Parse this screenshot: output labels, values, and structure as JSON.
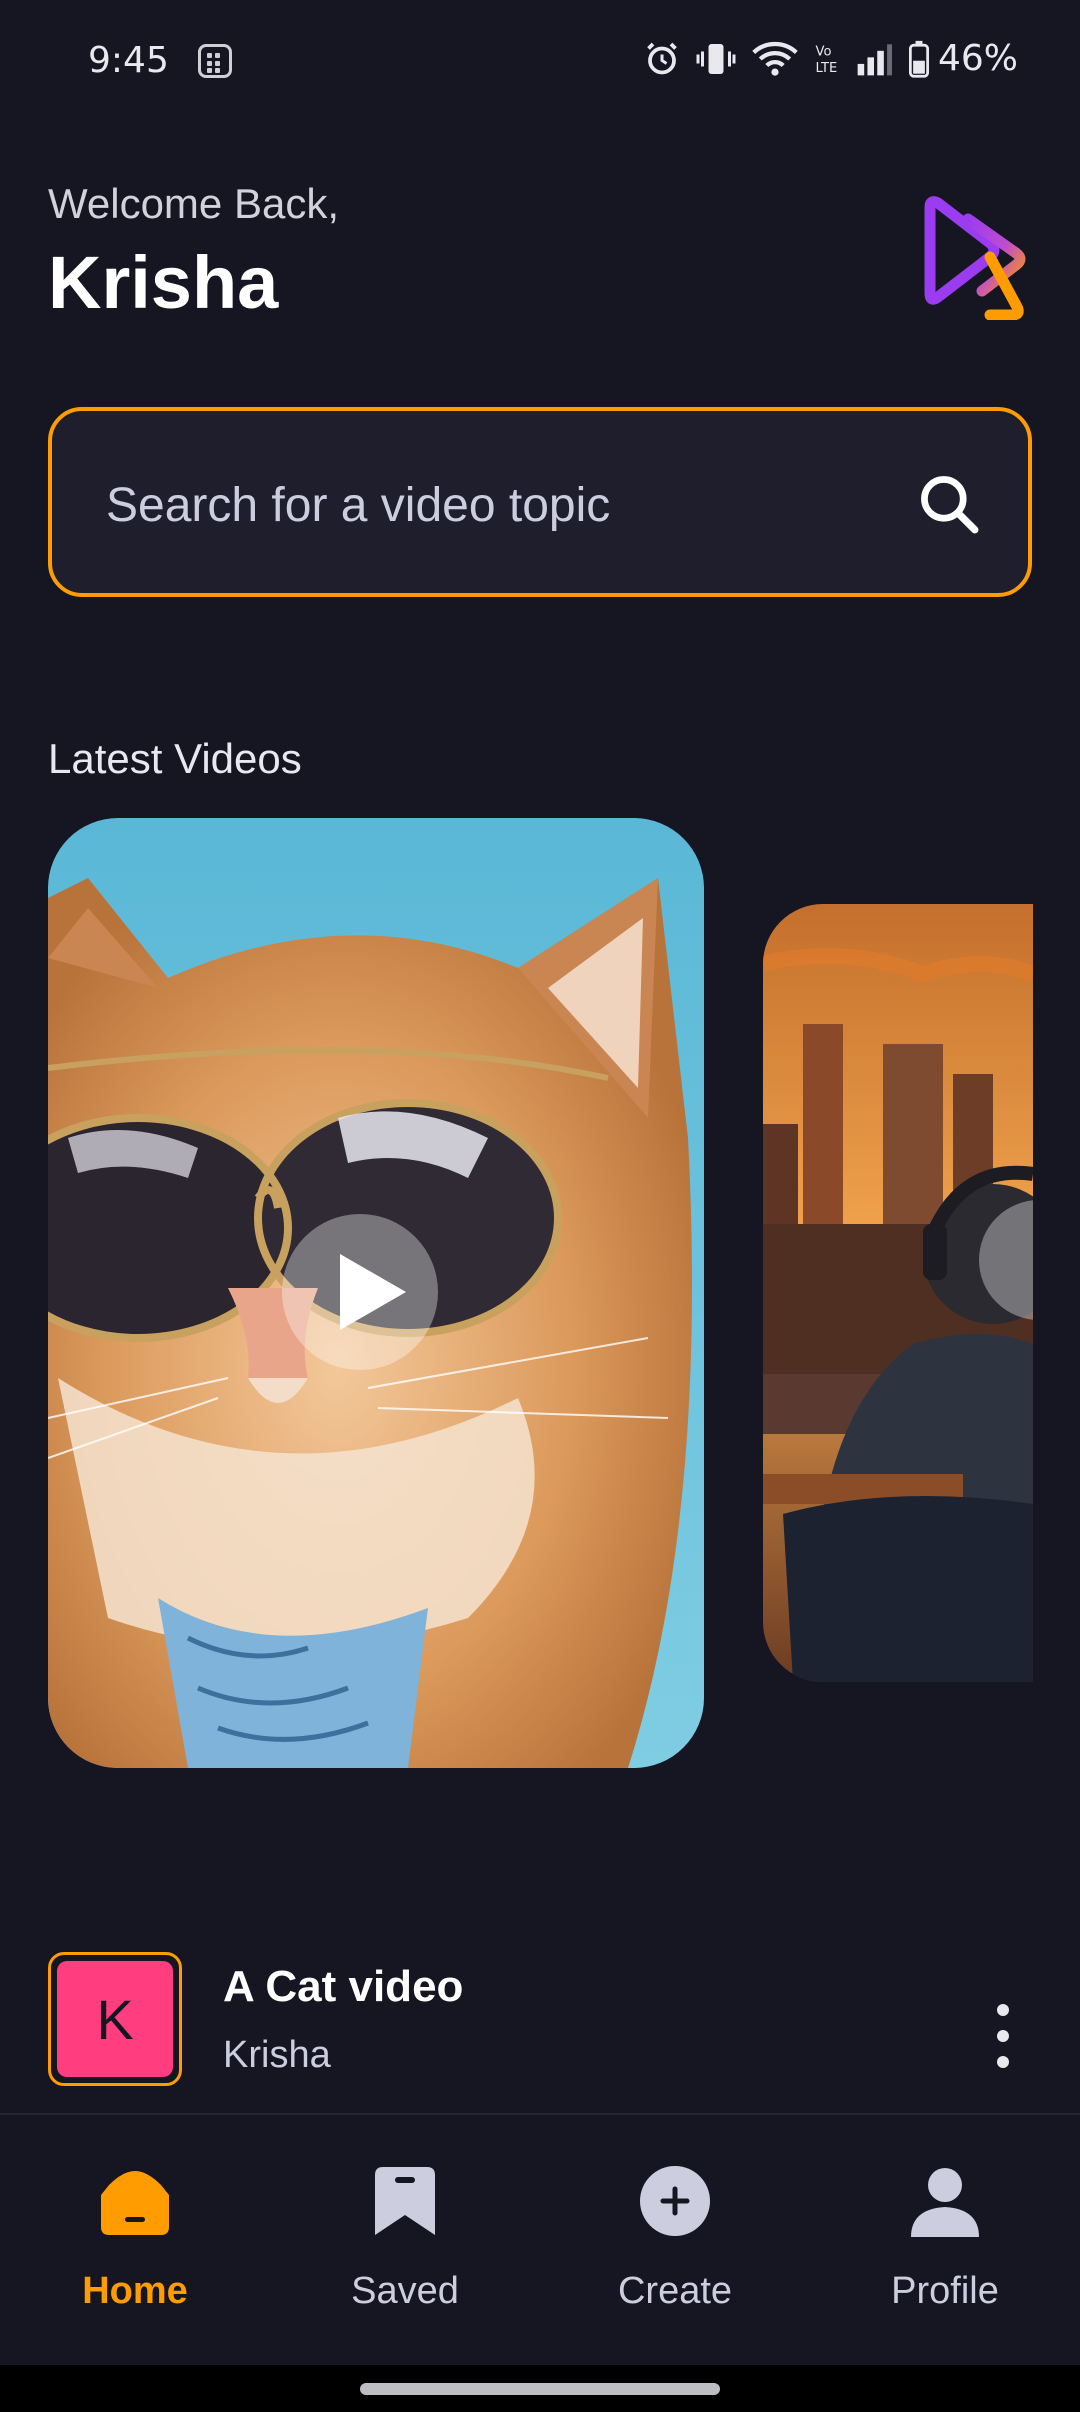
{
  "status_bar": {
    "time": "9:45",
    "battery": "46%"
  },
  "header": {
    "greeting": "Welcome Back,",
    "username": "Krisha"
  },
  "search": {
    "placeholder": "Search for a video topic"
  },
  "latest": {
    "title": "Latest Videos"
  },
  "video": {
    "title": "A Cat video",
    "author": "Krisha",
    "avatar_letter": "K"
  },
  "tabs": [
    {
      "label": "Home",
      "icon": "home-icon",
      "active": true
    },
    {
      "label": "Saved",
      "icon": "bookmark-icon",
      "active": false
    },
    {
      "label": "Create",
      "icon": "plus-circle-icon",
      "active": false
    },
    {
      "label": "Profile",
      "icon": "user-icon",
      "active": false
    }
  ],
  "colors": {
    "background": "#161622",
    "accent": "#ff9c01",
    "avatar": "#ff3d7f",
    "logo_gradient": [
      "#9b3cf0",
      "#ff9c01"
    ]
  }
}
